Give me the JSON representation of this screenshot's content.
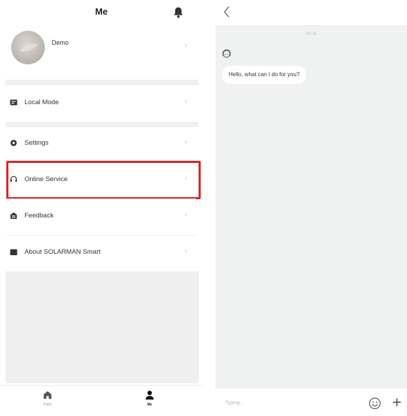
{
  "left": {
    "header": {
      "title": "Me"
    },
    "profile": {
      "name": "Demo"
    },
    "menu": [
      {
        "id": "local-mode",
        "label": "Local Mode",
        "icon": "local-mode-icon"
      },
      {
        "id": "settings",
        "label": "Settings",
        "icon": "gear-icon"
      },
      {
        "id": "online-service",
        "label": "Online Service",
        "icon": "headset-icon",
        "highlighted": true
      },
      {
        "id": "feedback",
        "label": "Feedback",
        "icon": "feedback-icon"
      },
      {
        "id": "about",
        "label": "About SOLARMAN Smart",
        "icon": "book-icon"
      }
    ],
    "tabbar": [
      {
        "label": "Plant",
        "icon": "house-icon",
        "active": false
      },
      {
        "label": "Me",
        "icon": "person-icon",
        "active": true
      }
    ],
    "highlight_color": "#e02020"
  },
  "right": {
    "timestamp": "09:26",
    "messages": [
      {
        "from": "agent",
        "text": "Hello, what can I do for you?"
      }
    ],
    "input": {
      "placeholder": "Typing..."
    }
  }
}
